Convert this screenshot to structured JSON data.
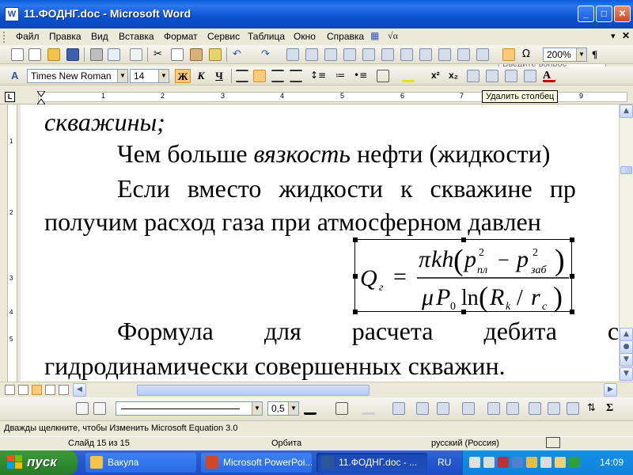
{
  "window": {
    "title": "11.ФОДНГ.doc - Microsoft Word",
    "icon_letter": "W"
  },
  "menu": {
    "items": [
      "Файл",
      "Правка",
      "Вид",
      "Вставка",
      "Формат",
      "Сервис",
      "Таблица",
      "Окно",
      "Справка"
    ],
    "help_placeholder": "Введите вопрос"
  },
  "standard_toolbar": {
    "zoom": "200%"
  },
  "formatting_toolbar": {
    "style": "Times New Roman",
    "font": "Times New Roman",
    "size": "14",
    "bold": "Ж",
    "italic": "К",
    "underline": "Ч"
  },
  "ruler": {
    "numbers": [
      "1",
      "2",
      "3",
      "4",
      "5",
      "6",
      "7",
      "8",
      "9"
    ],
    "tooltip": "Удалить столбец"
  },
  "vruler": {
    "numbers": [
      "1",
      "2",
      "3",
      "4",
      "5"
    ]
  },
  "document": {
    "line1": "скважины;",
    "line2_a": "Чем больше ",
    "line2_b": "вязкость",
    "line2_c": " нефти (жидкости)",
    "line3": "Если вместо жидкости к скважине пр",
    "line4": "получим расход газа при атмосферном давлен",
    "line5": "Формула для расчета дебита с",
    "line6": "гидродинамически совершенных скважин."
  },
  "equation": {
    "lhs": "Q",
    "lhs_sub": "г",
    "eq": "=",
    "num_pi": "π",
    "num_kh": "kh",
    "p": "p",
    "sub_pl": "пл",
    "sub_zab": "заб",
    "sup2": "2",
    "minus": "−",
    "den_mu": "μ",
    "den_P": "P",
    "sub0": "0",
    "ln": "ln",
    "R": "R",
    "sub_k": "k",
    "slash": "/",
    "r": "r",
    "sub_c": "c"
  },
  "drawing_toolbar": {
    "line_width": "0,5"
  },
  "status_hint": "Дважды щелкните, чтобы Изменить Microsoft Equation 3.0",
  "statusbar": {
    "slide": "Слайд 15 из 15",
    "design": "Орбита",
    "language": "русский (Россия)"
  },
  "taskbar": {
    "start": "пуск",
    "tasks": [
      {
        "label": "Вакула"
      },
      {
        "label": "Microsoft PowerPoi..."
      },
      {
        "label": "11.ФОДНГ.doc - ..."
      }
    ],
    "lang": "RU",
    "clock": "14:09"
  },
  "colors": {
    "titlebar": "#0A5BD8",
    "taskbar": "#2459CC",
    "start": "#2F8C2F",
    "active_button": "#FFC97A"
  }
}
